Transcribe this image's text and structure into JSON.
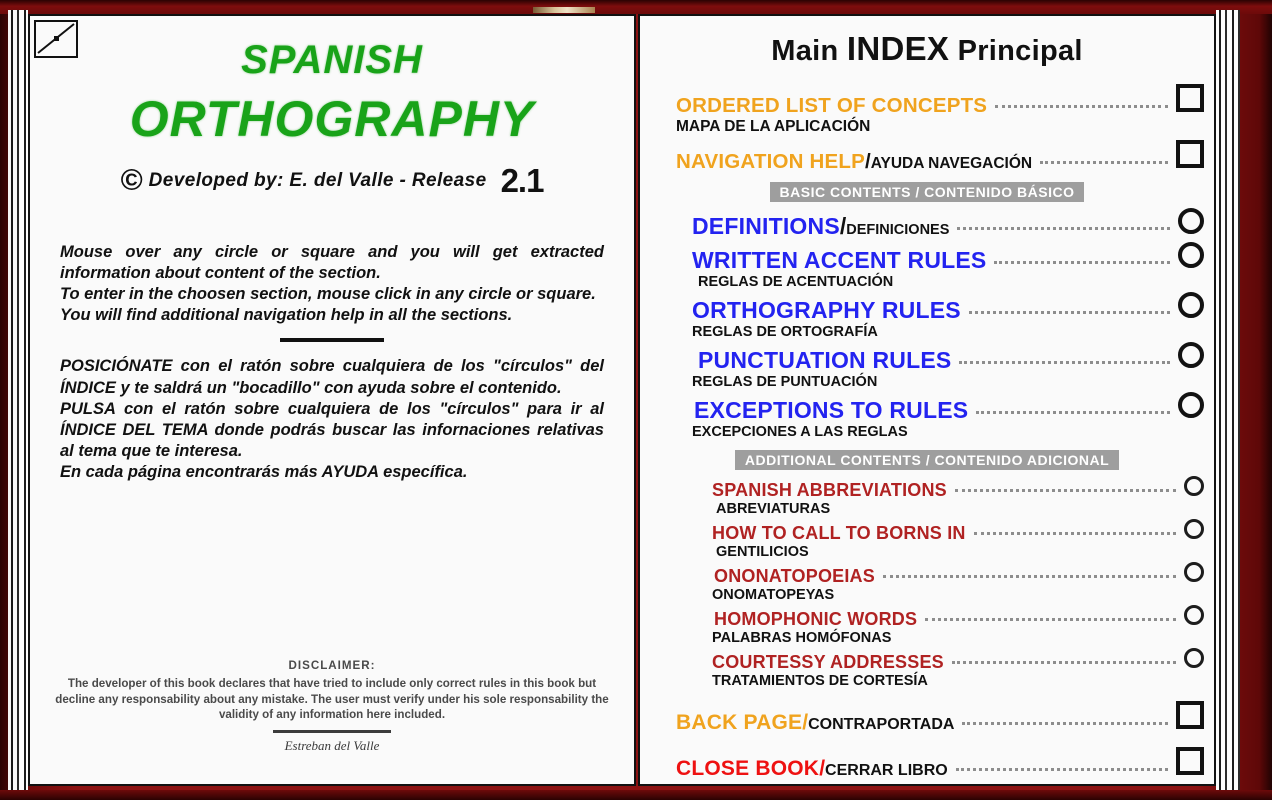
{
  "book": {
    "cover_color": "#8d1212",
    "ribbon_color": "#d9c49a"
  },
  "left_page": {
    "title_line1": "SPANISH",
    "title_line2": "ORTHOGRAPHY",
    "title_color": "#19a319",
    "copyright_symbol": "©",
    "credit": "Developed by:   E. del Valle -  Release",
    "release": "2.1",
    "english_instructions": [
      "Mouse over any circle or square and you will get extracted information about content of the section.",
      "To enter in the choosen section, mouse click in any circle or square.",
      "You will find additional navigation help in all the sections."
    ],
    "spanish_instructions": [
      "POSICIÓNATE con el ratón sobre cualquiera de los \"círculos\" del ÍNDICE y te saldrá un \"bocadillo\" con ayuda sobre el contenido.",
      "PULSA con el ratón sobre cualquiera de los \"círculos\" para ir al ÍNDICE DEL TEMA donde podrás buscar las infornaciones relativas al tema que te interesa.",
      "En cada página encontrarás más AYUDA específica."
    ],
    "disclaimer_title": "DISCLAIMER:",
    "disclaimer_body": "The developer of this book declares that have tried to include only correct rules in this book but decline any responsability about any mistake. The user must verify under his sole responsability the validity of any information here included.",
    "signature": "Estreban del Valle"
  },
  "right_page": {
    "title_part1": "Main ",
    "title_part2": "INDEX",
    "title_part3": " Principal",
    "top_rows": [
      {
        "en": "ORDERED LIST OF CONCEPTS",
        "es": "MAPA DE LA APLICACIÓN",
        "separator": "",
        "layout": "stacked",
        "marker": "square",
        "color": "#f0a31e"
      },
      {
        "en": "NAVIGATION HELP",
        "es": "AYUDA NAVEGACIÓN",
        "separator": " / ",
        "layout": "inline",
        "marker": "square",
        "color": "#f0a31e"
      }
    ],
    "basic_band": "BASIC CONTENTS / CONTENIDO BÁSICO",
    "basic_rows": [
      {
        "en": "DEFINITIONS",
        "es": "DEFINICIONES",
        "separator": " / ",
        "layout": "inline",
        "marker": "circle",
        "color": "#2323f0"
      },
      {
        "en": "WRITTEN ACCENT RULES",
        "es": "REGLAS DE ACENTUACIÓN",
        "separator": "",
        "layout": "stacked",
        "marker": "circle",
        "color": "#2323f0"
      },
      {
        "en": "ORTHOGRAPHY RULES",
        "es": "REGLAS DE ORTOGRAFÍA",
        "separator": "",
        "layout": "stacked",
        "marker": "circle",
        "color": "#2323f0"
      },
      {
        "en": "PUNCTUATION RULES",
        "es": "REGLAS DE PUNTUACIÓN",
        "separator": "",
        "layout": "stacked",
        "marker": "circle",
        "color": "#2323f0"
      },
      {
        "en": "EXCEPTIONS TO RULES",
        "es": "EXCEPCIONES A LAS REGLAS",
        "separator": "",
        "layout": "stacked",
        "marker": "circle",
        "color": "#2323f0"
      }
    ],
    "additional_band": "ADDITIONAL CONTENTS / CONTENIDO ADICIONAL",
    "additional_rows": [
      {
        "en": "SPANISH ABBREVIATIONS",
        "es": "ABREVIATURAS",
        "separator": "",
        "layout": "stacked",
        "marker": "circle-small",
        "color": "#b02222"
      },
      {
        "en": "HOW TO CALL TO BORNS IN",
        "es": "GENTILICIOS",
        "separator": "",
        "layout": "stacked",
        "marker": "circle-small",
        "color": "#b02222"
      },
      {
        "en": "ONONATOPOEIAS",
        "es": "ONOMATOPEYAS",
        "separator": "",
        "layout": "stacked",
        "marker": "circle-small",
        "color": "#b02222"
      },
      {
        "en": "HOMOPHONIC  WORDS",
        "es": "PALABRAS HOMÓFONAS",
        "separator": "",
        "layout": "stacked",
        "marker": "circle-small",
        "color": "#b02222"
      },
      {
        "en": "COURTESSY ADDRESSES",
        "es": "TRATAMIENTOS DE CORTESÍA",
        "separator": "",
        "layout": "stacked",
        "marker": "circle-small",
        "color": "#b02222"
      }
    ],
    "bottom_rows": [
      {
        "en": "BACK PAGE",
        "es": "CONTRAPORTADA",
        "separator": " / ",
        "layout": "inline",
        "marker": "square",
        "color": "#f0a31e"
      },
      {
        "en": "CLOSE BOOK",
        "es": "CERRAR LIBRO",
        "separator": " / ",
        "layout": "inline",
        "marker": "square",
        "color": "#ee1111"
      }
    ]
  }
}
